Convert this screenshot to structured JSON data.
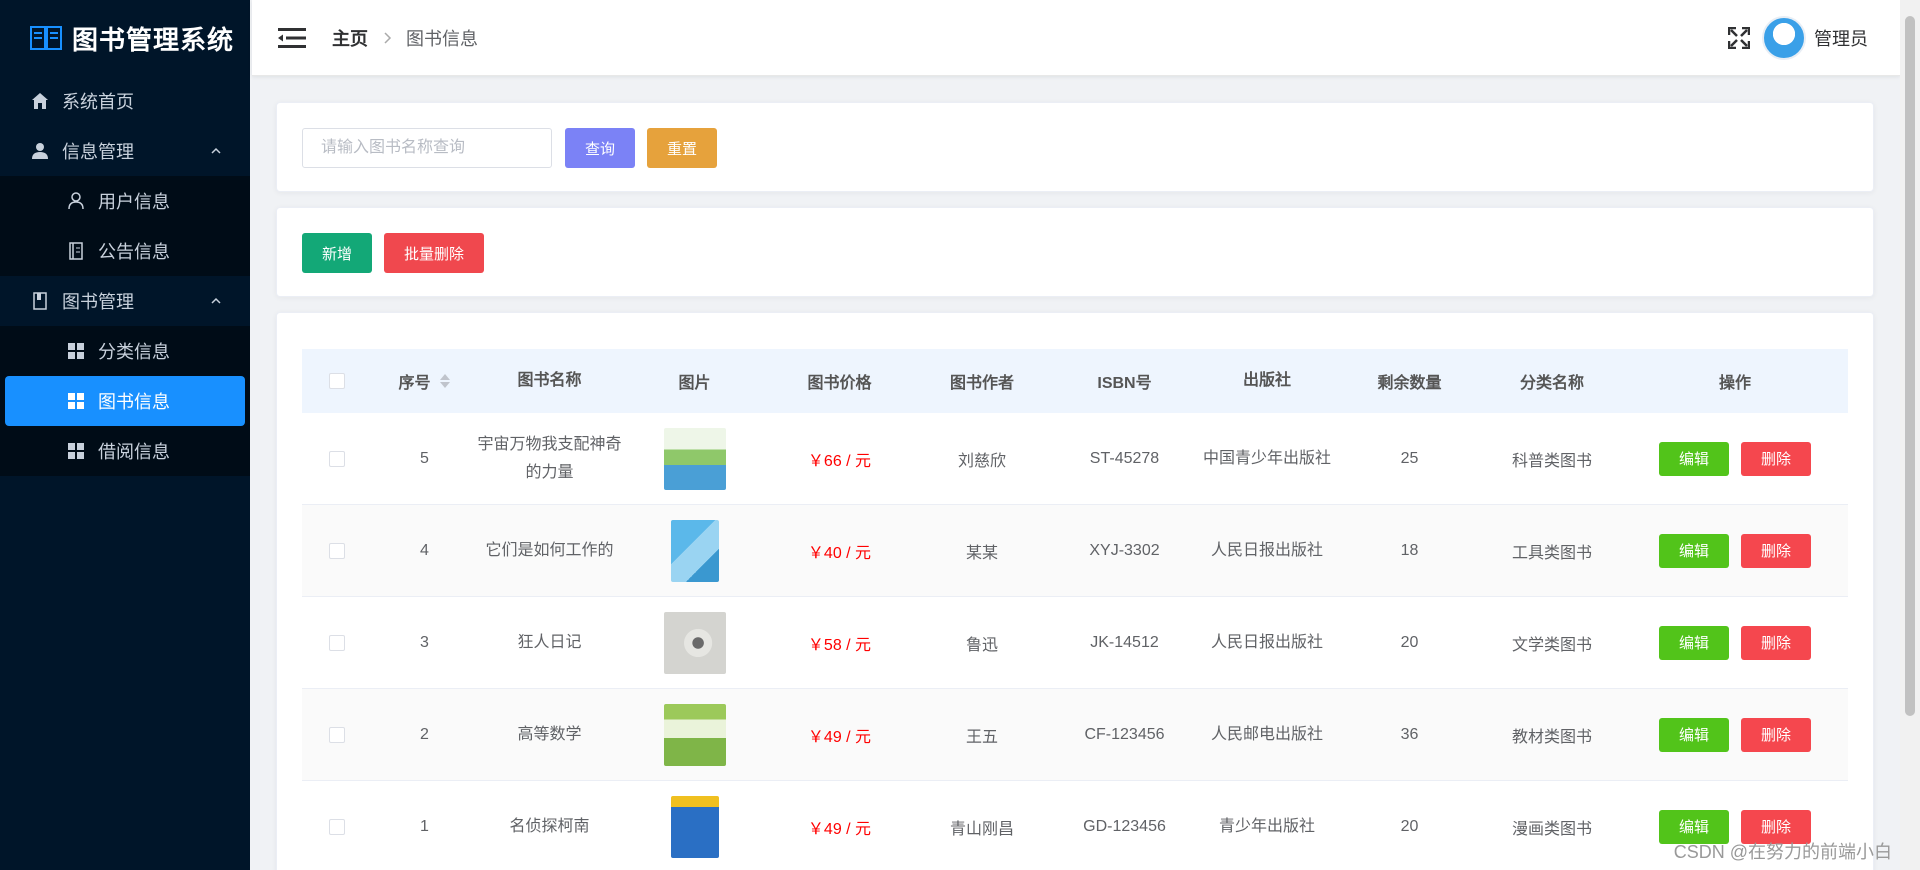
{
  "app": {
    "title": "图书管理系统"
  },
  "sidebar": {
    "items": [
      {
        "label": "系统首页",
        "icon": "home-icon"
      },
      {
        "label": "信息管理",
        "icon": "user-icon"
      },
      {
        "label": "用户信息",
        "icon": "user-outline-icon"
      },
      {
        "label": "公告信息",
        "icon": "notice-icon"
      },
      {
        "label": "图书管理",
        "icon": "book-icon"
      },
      {
        "label": "分类信息",
        "icon": "grid-icon"
      },
      {
        "label": "图书信息",
        "icon": "grid-icon"
      },
      {
        "label": "借阅信息",
        "icon": "grid-icon"
      }
    ]
  },
  "header": {
    "breadcrumb_home": "主页",
    "breadcrumb_current": "图书信息",
    "username": "管理员"
  },
  "search": {
    "placeholder": "请输入图书名称查询",
    "query_label": "查询",
    "reset_label": "重置"
  },
  "actions": {
    "add_label": "新增",
    "batch_delete_label": "批量删除"
  },
  "table": {
    "columns": [
      "序号",
      "图书名称",
      "图片",
      "图书价格",
      "图书作者",
      "ISBN号",
      "出版社",
      "剩余数量",
      "分类名称",
      "操作"
    ],
    "edit_label": "编辑",
    "delete_label": "删除",
    "rows": [
      {
        "id": "5",
        "name": "宇宙万物我支配神奇的力量",
        "price": "￥66 / 元",
        "author": "刘慈欣",
        "isbn": "ST-45278",
        "publisher": "中国青少年出版社",
        "stock": "25",
        "category": "科普类图书"
      },
      {
        "id": "4",
        "name": "它们是如何工作的",
        "price": "￥40 / 元",
        "author": "某某",
        "isbn": "XYJ-3302",
        "publisher": "人民日报出版社",
        "stock": "18",
        "category": "工具类图书"
      },
      {
        "id": "3",
        "name": "狂人日记",
        "price": "￥58 / 元",
        "author": "鲁迅",
        "isbn": "JK-14512",
        "publisher": "人民日报出版社",
        "stock": "20",
        "category": "文学类图书"
      },
      {
        "id": "2",
        "name": "高等数学",
        "price": "￥49 / 元",
        "author": "王五",
        "isbn": "CF-123456",
        "publisher": "人民邮电出版社",
        "stock": "36",
        "category": "教材类图书"
      },
      {
        "id": "1",
        "name": "名侦探柯南",
        "price": "￥49 / 元",
        "author": "青山刚昌",
        "isbn": "GD-123456",
        "publisher": "青少年出版社",
        "stock": "20",
        "category": "漫画类图书"
      }
    ]
  },
  "watermark": "CSDN @在努力的前端小白",
  "colors": {
    "sidebar_bg": "#001529",
    "active": "#1890ff",
    "price": "#ff0000"
  }
}
